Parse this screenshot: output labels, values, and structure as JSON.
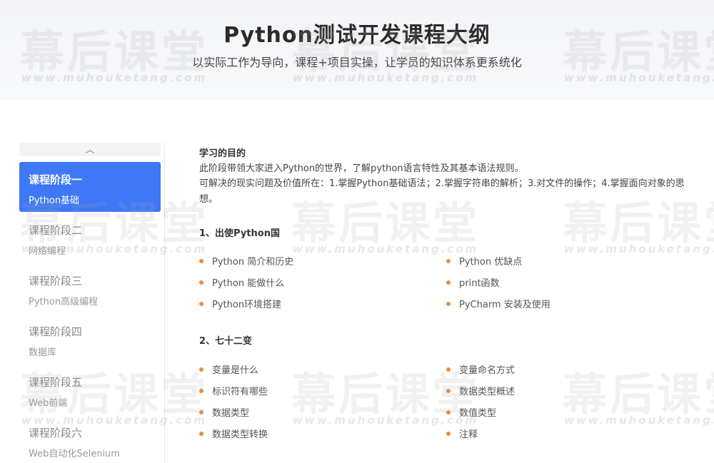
{
  "header": {
    "title": "Python测试开发课程大纲",
    "subtitle": "以实际工作为导向，课程+项目实操，让学员的知识体系更系统化"
  },
  "watermark": {
    "text": "幕后课堂",
    "url": "www.muhouketang.com"
  },
  "sidebar": {
    "up_arrow": "︿",
    "stages": [
      {
        "title": "课程阶段一",
        "subtitle": "Python基础"
      },
      {
        "title": "课程阶段二",
        "subtitle": "网络编程"
      },
      {
        "title": "课程阶段三",
        "subtitle": "Python高级编程"
      },
      {
        "title": "课程阶段四",
        "subtitle": "数据库"
      },
      {
        "title": "课程阶段五",
        "subtitle": "Web前端"
      },
      {
        "title": "课程阶段六",
        "subtitle": "Web自动化Selenium"
      }
    ]
  },
  "content": {
    "goal_heading": "学习的目的",
    "goal_line1": "此阶段带领大家进入Python的世界，了解python语言特性及其基本语法规则。",
    "goal_line2": "可解决的现实问题及价值所在：1.掌握Python基础语法；2.掌握字符串的解析；3.对文件的操作；4.掌握面向对象的思想。",
    "sections": [
      {
        "title": "1、出使Python国",
        "items": [
          "Python 简介和历史",
          "Python 优缺点",
          "Python 能做什么",
          "print函数",
          "Python环境搭建",
          "PyCharm 安装及使用"
        ]
      },
      {
        "title": "2、七十二变",
        "items": [
          "变量是什么",
          "变量命名方式",
          "标识符有哪些",
          "数据类型概述",
          "数据类型",
          "数值类型",
          "数据类型转换",
          "注释"
        ]
      }
    ]
  },
  "colors": {
    "accent": "#3f78f6",
    "bullet": "#f0893a"
  }
}
